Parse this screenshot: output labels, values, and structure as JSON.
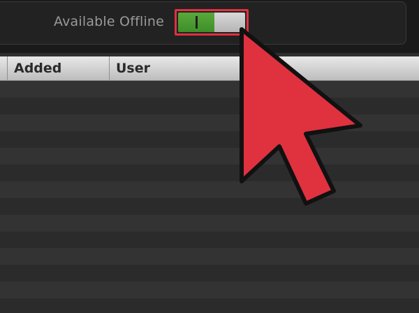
{
  "offline": {
    "label": "Available Offline",
    "toggle_state": "on"
  },
  "table": {
    "columns": [
      "Added",
      "User"
    ]
  },
  "colors": {
    "toggle_on": "#4a9b32",
    "toggle_off": "#c8c8c8",
    "highlight": "#e0313f",
    "pointer_fill": "#e0313f"
  },
  "icons": {
    "pointer": "arrow-pointer-icon"
  }
}
